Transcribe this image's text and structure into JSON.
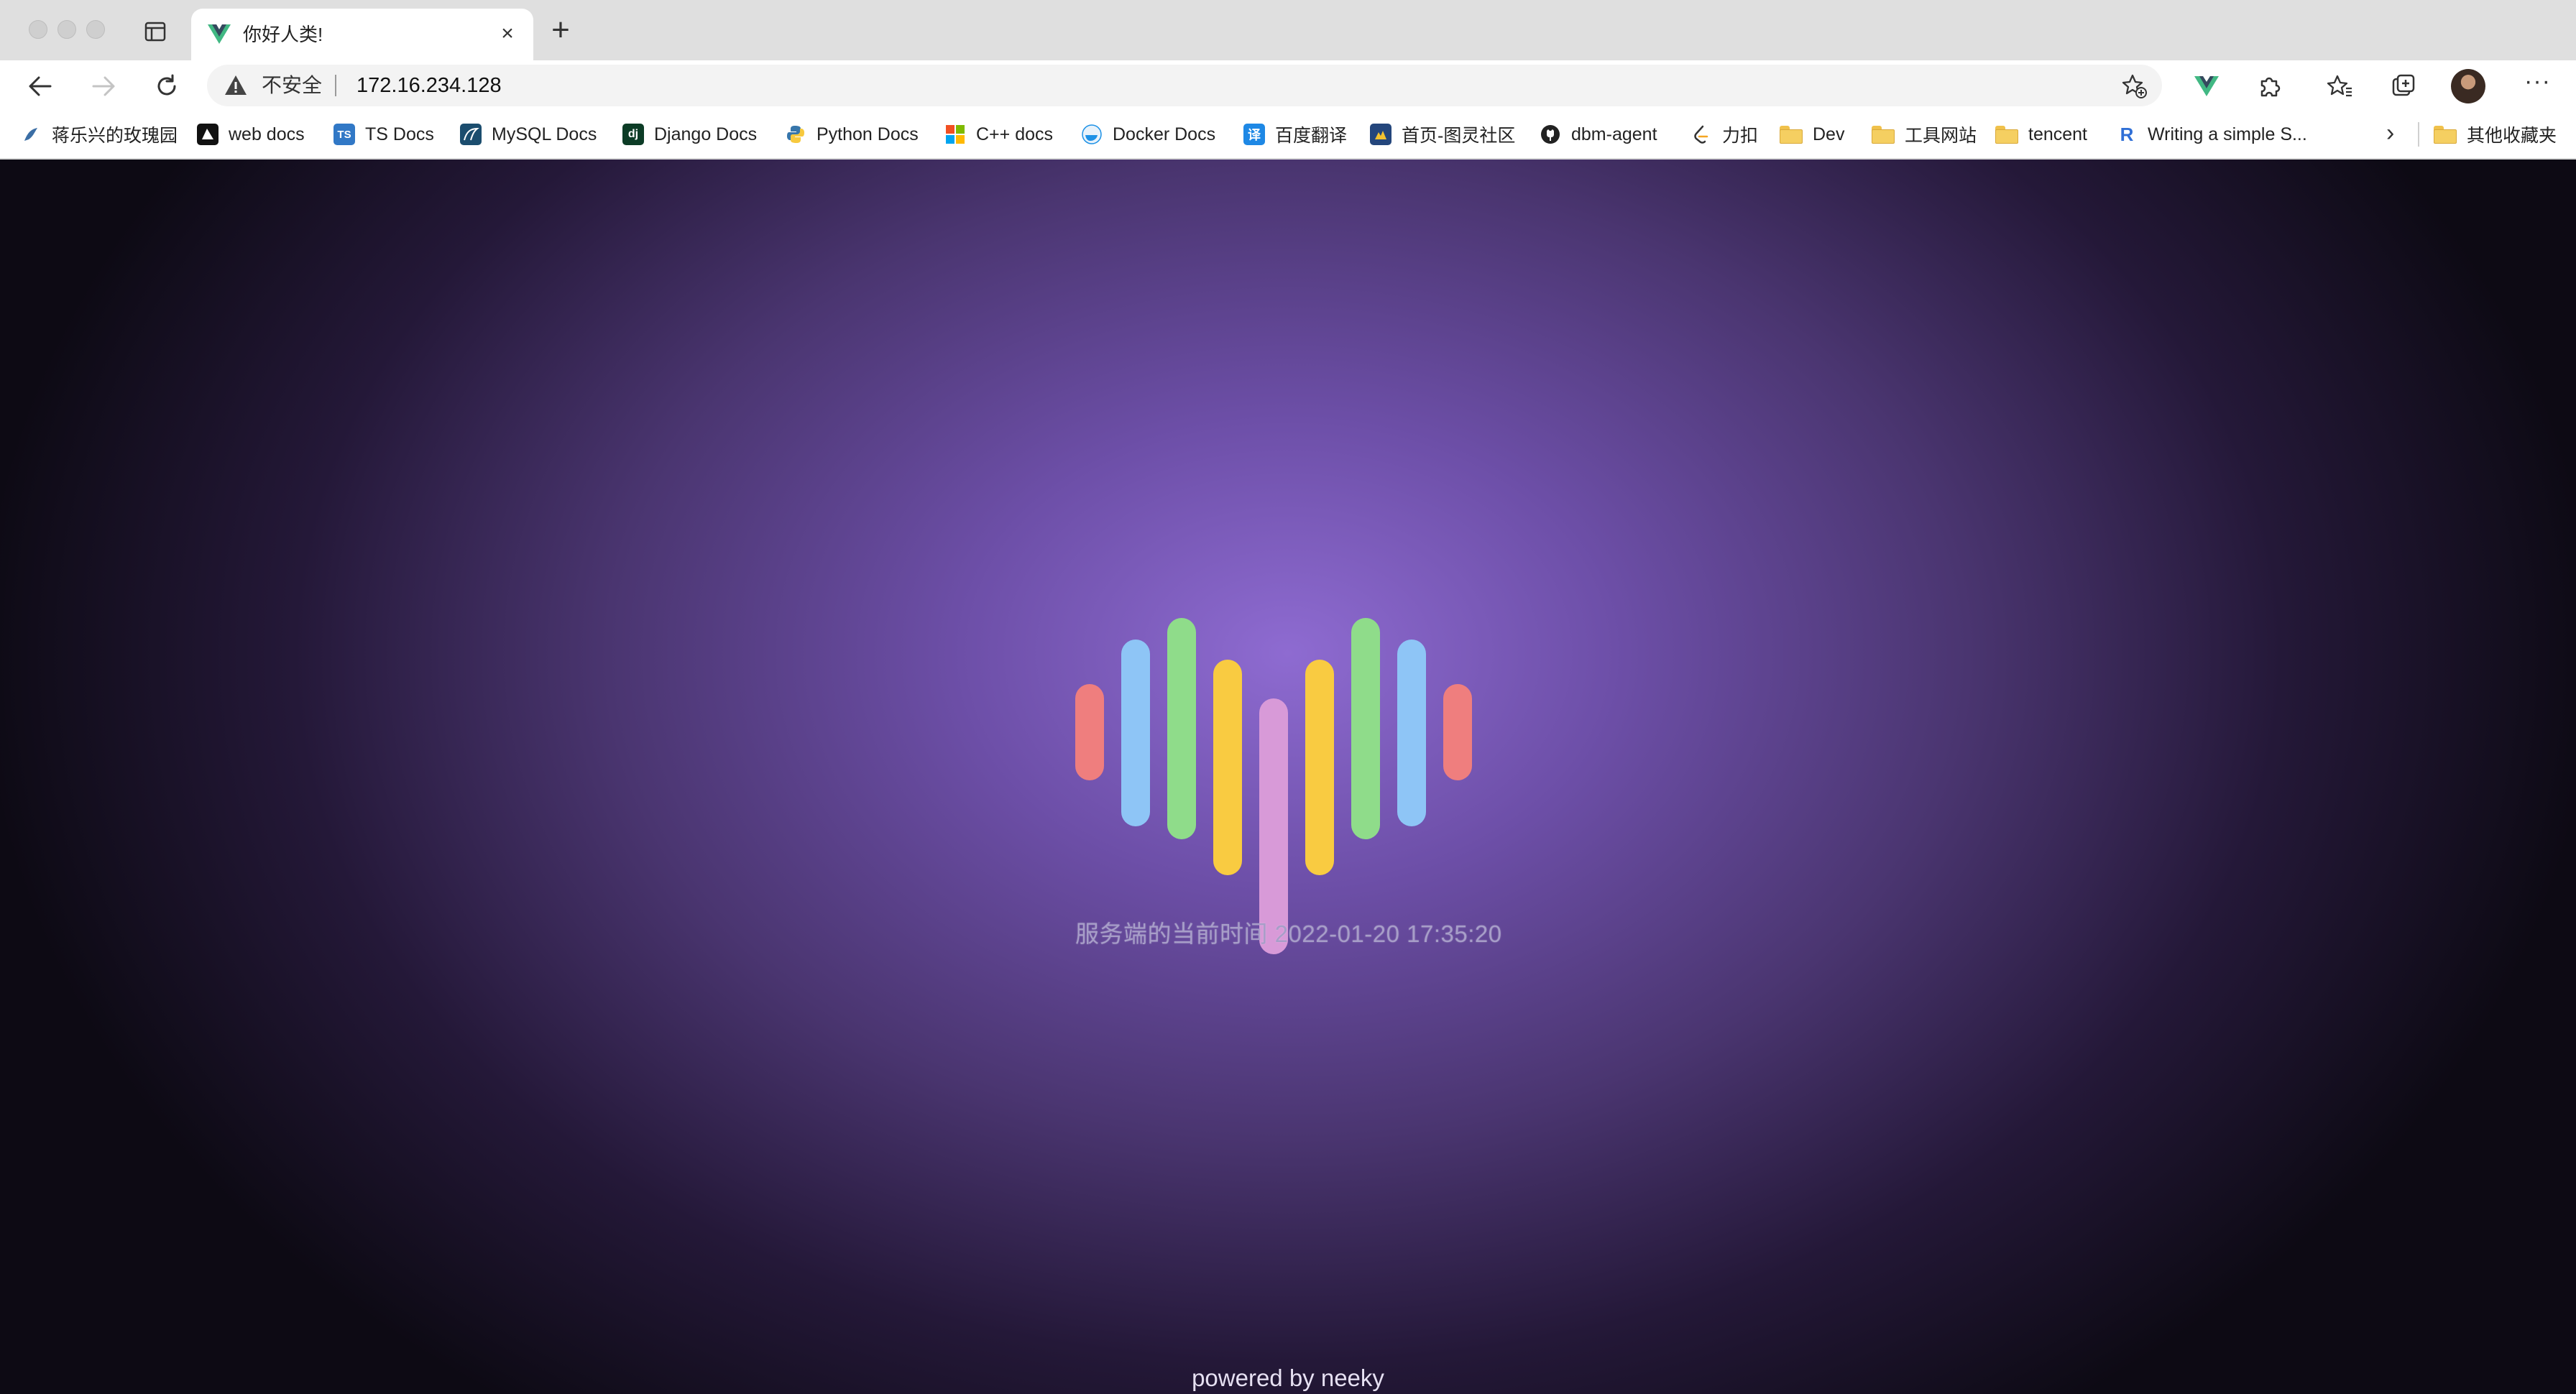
{
  "browser": {
    "tab": {
      "title": "你好人类!",
      "close_glyph": "×"
    },
    "new_tab_glyph": "+",
    "address": {
      "security_label": "不安全",
      "url": "172.16.234.128"
    },
    "bookmarks": [
      {
        "label": "蒋乐兴的玫瑰园",
        "icon": "bird-icon"
      },
      {
        "label": "web docs",
        "icon": "mdn-icon"
      },
      {
        "label": "TS Docs",
        "icon": "ts-icon",
        "icon_text": "TS"
      },
      {
        "label": "MySQL Docs",
        "icon": "mysql-icon"
      },
      {
        "label": "Django Docs",
        "icon": "django-icon",
        "icon_text": "dj"
      },
      {
        "label": "Python Docs",
        "icon": "python-icon"
      },
      {
        "label": "C++ docs",
        "icon": "microsoft-icon"
      },
      {
        "label": "Docker Docs",
        "icon": "docker-icon"
      },
      {
        "label": "百度翻译",
        "icon": "baidu-translate-icon",
        "icon_text": "译"
      },
      {
        "label": "首页-图灵社区",
        "icon": "turing-icon"
      },
      {
        "label": "dbm-agent",
        "icon": "github-icon"
      },
      {
        "label": "力扣",
        "icon": "leetcode-icon"
      },
      {
        "label": "Dev",
        "icon": "folder-icon"
      },
      {
        "label": "工具网站",
        "icon": "folder-icon"
      },
      {
        "label": "tencent",
        "icon": "folder-icon"
      },
      {
        "label": "Writing a simple S...",
        "icon": "r-icon",
        "icon_text": "R"
      }
    ],
    "overflow_glyph": "›",
    "other_bookmarks": "其他收藏夹"
  },
  "page": {
    "server_time": "服务端的当前时间 2022-01-20 17:35:20",
    "footer": "powered by neeky",
    "heart_bar_colors": [
      "#ef7e7e",
      "#8ec5f6",
      "#8fdc8a",
      "#f9cb41",
      "#d89ad8",
      "#f9cb41",
      "#8fdc8a",
      "#8ec5f6",
      "#ef7e7e"
    ]
  }
}
